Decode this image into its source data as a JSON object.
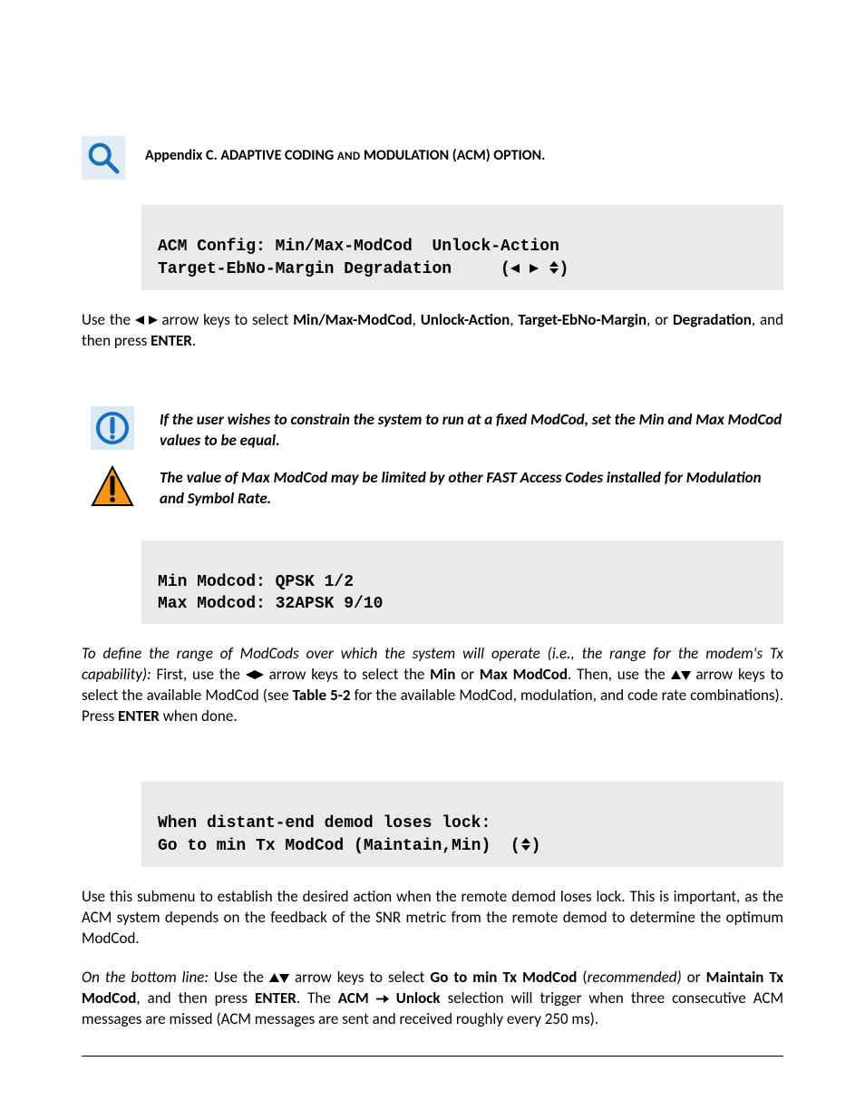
{
  "header": {
    "appendix_prefix": "Appendix C. ADAPTIVE CODING ",
    "appendix_small": "AND",
    "appendix_suffix": " MODULATION (ACM) OPTION."
  },
  "lcd1": {
    "line1": "ACM Config: Min/Max-ModCod  Unlock-Action",
    "line2_left": "Target-EbNo-Margin Degradation     ("
  },
  "para1": {
    "t1": "Use the  ",
    "t2": "  arrow keys to select ",
    "b1": "Min/Max-ModCod",
    "t3": ", ",
    "b2": "Unlock-Action",
    "t4": ", ",
    "b3": "Target-EbNo-Margin",
    "t5": ", or ",
    "b4": "Degradation",
    "t6": ", and then press ",
    "b5": "ENTER",
    "t7": "."
  },
  "note_info": "If the user wishes to constrain the system to run at a fixed ModCod, set the Min and Max ModCod values to be equal.",
  "note_warn": "The value of Max ModCod may be limited by other FAST Access Codes installed for Modulation and Symbol Rate.",
  "lcd2": {
    "line1": "Min Modcod: QPSK 1/2",
    "line2": "Max Modcod: 32APSK 9/10"
  },
  "para2": {
    "i1": "To define the range of ModCods over which the system will operate (i.e., the range for the modem's Tx capability):",
    "t1": " First, use the ",
    "t2": " arrow keys to select the ",
    "b1": "Min",
    "t3": " or ",
    "b2": "Max ModCod",
    "t4": ". Then, use the  ",
    "t5": "  arrow keys to select the available ModCod (see  ",
    "b3": "Table 5-2",
    "t6": " for the available ModCod, modulation, and code rate combinations). Press ",
    "b4": "ENTER",
    "t7": " when done."
  },
  "lcd3": {
    "line1": "When distant-end demod loses lock:",
    "line2_left": "Go to min Tx ModCod (Maintain,Min)  ("
  },
  "para3": "Use this submenu to establish the desired action when the remote demod loses lock. This is important, as the ACM system depends on the feedback of the SNR metric from the remote demod to determine the optimum ModCod.",
  "para4": {
    "i1": "On the bottom line:",
    "t1": " Use the ",
    "t2": " arrow keys to select ",
    "b1": "Go to min Tx ModCod",
    "t3": " (",
    "i2": "recommended)",
    "t4": " or ",
    "b2": "Maintain Tx ModCod",
    "t5": ", and then press ",
    "b3": "ENTER",
    "t6": ". The ",
    "b4": "ACM",
    "t7": " ",
    "b5": "Unlock",
    "t8": " selection will trigger when three consecutive ACM messages are missed (ACM messages are sent and received roughly every 250 ms)."
  }
}
